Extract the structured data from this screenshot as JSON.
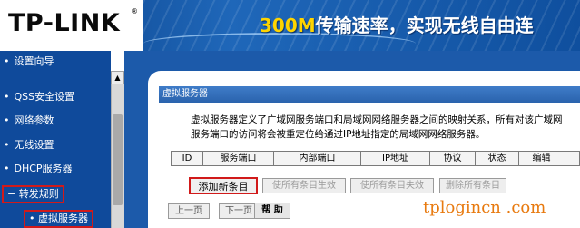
{
  "header": {
    "logo": "TP-LINK",
    "logo_reg": "®",
    "slogan_highlight": "300M",
    "slogan_rest": "传输速率，实现无线自由连"
  },
  "sidebar": {
    "items": [
      {
        "label": "设置向导"
      },
      {
        "label": "QSS安全设置"
      },
      {
        "label": "网络参数"
      },
      {
        "label": "无线设置"
      },
      {
        "label": "DHCP服务器"
      },
      {
        "label": "转发规则"
      },
      {
        "label": "虚拟服务器"
      }
    ],
    "bullet": "•",
    "expanded_marker": "−"
  },
  "scrollbar": {
    "up_arrow": "▲"
  },
  "panel": {
    "title": "虚拟服务器",
    "description_line1": "虚拟服务器定义了广域网服务端口和局域网网络服务器之间的映射关系，所有对该广域网",
    "description_line2": "服务端口的访问将会被重定位给通过IP地址指定的局域网网络服务器。"
  },
  "table": {
    "headers": [
      "ID",
      "服务端口",
      "内部端口",
      "IP地址",
      "协议",
      "状态",
      "编辑"
    ]
  },
  "actions": {
    "add": "添加新条目",
    "enable_all": "使所有条目生效",
    "disable_all": "使所有条目失效",
    "delete_all": "删除所有条目"
  },
  "pager": {
    "prev": "上一页",
    "next": "下一页",
    "help": "帮 助"
  },
  "watermark": "tplogincn .com",
  "colors": {
    "header_blue": "#1f67b9",
    "sidebar_blue": "#0f4a9b",
    "highlight_red": "#d11a1a",
    "slogan_yellow": "#ffd400"
  }
}
